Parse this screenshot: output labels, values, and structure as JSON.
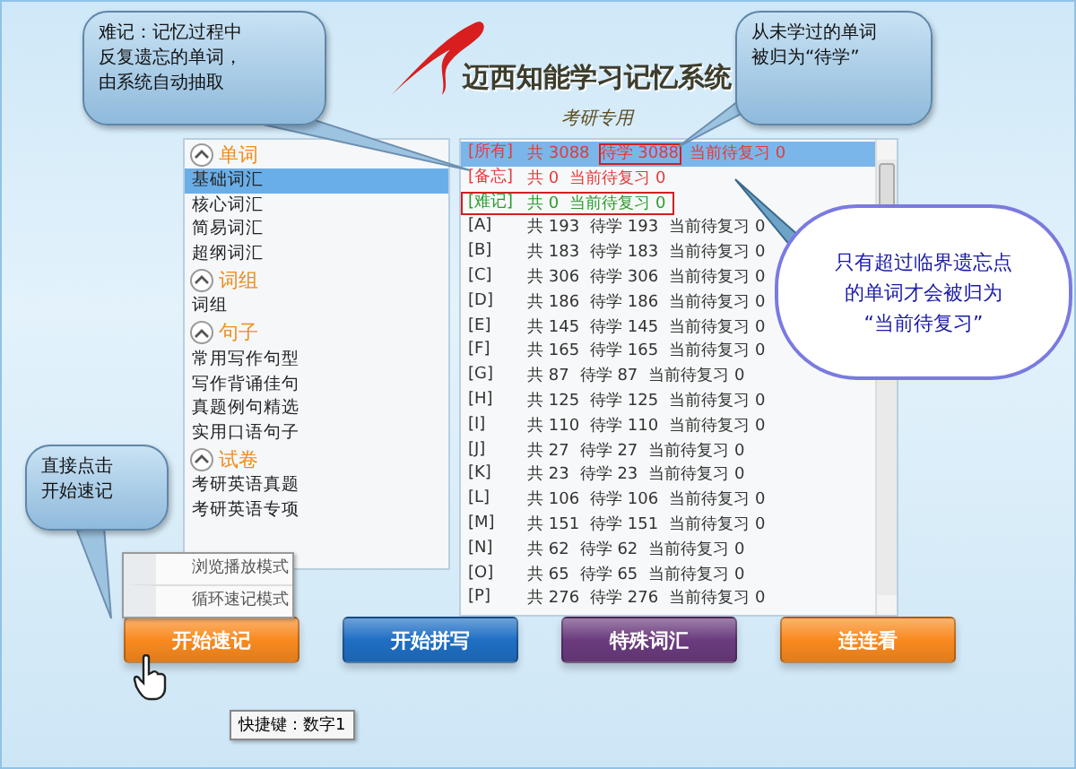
{
  "logo": {
    "title": "迈西知能学习记忆系统",
    "subtitle": "考研专用"
  },
  "sidebar": {
    "groups": [
      {
        "title": "单词",
        "expanded": true,
        "items": [
          {
            "label": "基础词汇",
            "selected": true
          },
          {
            "label": "核心词汇",
            "selected": false
          },
          {
            "label": "简易词汇",
            "selected": false
          },
          {
            "label": "超纲词汇",
            "selected": false
          }
        ]
      },
      {
        "title": "词组",
        "expanded": true,
        "items": [
          {
            "label": "词组",
            "selected": false
          }
        ]
      },
      {
        "title": "句子",
        "expanded": true,
        "items": [
          {
            "label": "常用写作句型",
            "selected": false
          },
          {
            "label": "写作背诵佳句",
            "selected": false
          },
          {
            "label": "真题例句精选",
            "selected": false
          },
          {
            "label": "实用口语句子",
            "selected": false
          }
        ]
      },
      {
        "title": "试卷",
        "expanded": true,
        "items": [
          {
            "label": "考研英语真题",
            "selected": false
          },
          {
            "label": "考研英语专项",
            "selected": false
          }
        ]
      }
    ]
  },
  "word_list": {
    "rows": [
      {
        "kind": "all",
        "tag": "[所有]",
        "selected": true,
        "boxed": false,
        "segments": [
          {
            "text": "共 3088",
            "boxed": false
          },
          {
            "text": "待学 3088",
            "boxed": true
          },
          {
            "text": "当前待复习 0",
            "boxed": false
          }
        ]
      },
      {
        "kind": "memo",
        "tag": "[备忘]",
        "selected": false,
        "boxed": false,
        "segments": [
          {
            "text": "共 0",
            "boxed": false
          },
          {
            "text": "当前待复习 0",
            "boxed": false
          }
        ]
      },
      {
        "kind": "hard",
        "tag": "[难记]",
        "selected": false,
        "boxed": true,
        "segments": [
          {
            "text": "共 0",
            "boxed": false
          },
          {
            "text": "当前待复习 0",
            "boxed": false
          }
        ]
      },
      {
        "kind": "letter",
        "tag": "[A]",
        "selected": false,
        "boxed": false,
        "segments": [
          {
            "text": "共 193",
            "boxed": false
          },
          {
            "text": "待学 193",
            "boxed": false
          },
          {
            "text": "当前待复习 0",
            "boxed": false
          }
        ]
      },
      {
        "kind": "letter",
        "tag": "[B]",
        "selected": false,
        "boxed": false,
        "segments": [
          {
            "text": "共 183",
            "boxed": false
          },
          {
            "text": "待学 183",
            "boxed": false
          },
          {
            "text": "当前待复习 0",
            "boxed": false
          }
        ]
      },
      {
        "kind": "letter",
        "tag": "[C]",
        "selected": false,
        "boxed": false,
        "segments": [
          {
            "text": "共 306",
            "boxed": false
          },
          {
            "text": "待学 306",
            "boxed": false
          },
          {
            "text": "当前待复习 0",
            "boxed": false
          }
        ]
      },
      {
        "kind": "letter",
        "tag": "[D]",
        "selected": false,
        "boxed": false,
        "segments": [
          {
            "text": "共 186",
            "boxed": false
          },
          {
            "text": "待学 186",
            "boxed": false
          },
          {
            "text": "当前待复习 0",
            "boxed": false
          }
        ]
      },
      {
        "kind": "letter",
        "tag": "[E]",
        "selected": false,
        "boxed": false,
        "segments": [
          {
            "text": "共 145",
            "boxed": false
          },
          {
            "text": "待学 145",
            "boxed": false
          },
          {
            "text": "当前待复习 0",
            "boxed": false
          }
        ]
      },
      {
        "kind": "letter",
        "tag": "[F]",
        "selected": false,
        "boxed": false,
        "segments": [
          {
            "text": "共 165",
            "boxed": false
          },
          {
            "text": "待学 165",
            "boxed": false
          },
          {
            "text": "当前待复习 0",
            "boxed": false
          }
        ]
      },
      {
        "kind": "letter",
        "tag": "[G]",
        "selected": false,
        "boxed": false,
        "segments": [
          {
            "text": "共 87",
            "boxed": false
          },
          {
            "text": "待学 87",
            "boxed": false
          },
          {
            "text": "当前待复习 0",
            "boxed": false
          }
        ]
      },
      {
        "kind": "letter",
        "tag": "[H]",
        "selected": false,
        "boxed": false,
        "segments": [
          {
            "text": "共 125",
            "boxed": false
          },
          {
            "text": "待学 125",
            "boxed": false
          },
          {
            "text": "当前待复习 0",
            "boxed": false
          }
        ]
      },
      {
        "kind": "letter",
        "tag": "[I]",
        "selected": false,
        "boxed": false,
        "segments": [
          {
            "text": "共 110",
            "boxed": false
          },
          {
            "text": "待学 110",
            "boxed": false
          },
          {
            "text": "当前待复习 0",
            "boxed": false
          }
        ]
      },
      {
        "kind": "letter",
        "tag": "[J]",
        "selected": false,
        "boxed": false,
        "segments": [
          {
            "text": "共 27",
            "boxed": false
          },
          {
            "text": "待学 27",
            "boxed": false
          },
          {
            "text": "当前待复习 0",
            "boxed": false
          }
        ]
      },
      {
        "kind": "letter",
        "tag": "[K]",
        "selected": false,
        "boxed": false,
        "segments": [
          {
            "text": "共 23",
            "boxed": false
          },
          {
            "text": "待学 23",
            "boxed": false
          },
          {
            "text": "当前待复习 0",
            "boxed": false
          }
        ]
      },
      {
        "kind": "letter",
        "tag": "[L]",
        "selected": false,
        "boxed": false,
        "segments": [
          {
            "text": "共 106",
            "boxed": false
          },
          {
            "text": "待学 106",
            "boxed": false
          },
          {
            "text": "当前待复习 0",
            "boxed": false
          }
        ]
      },
      {
        "kind": "letter",
        "tag": "[M]",
        "selected": false,
        "boxed": false,
        "segments": [
          {
            "text": "共 151",
            "boxed": false
          },
          {
            "text": "待学 151",
            "boxed": false
          },
          {
            "text": "当前待复习 0",
            "boxed": false
          }
        ]
      },
      {
        "kind": "letter",
        "tag": "[N]",
        "selected": false,
        "boxed": false,
        "segments": [
          {
            "text": "共 62",
            "boxed": false
          },
          {
            "text": "待学 62",
            "boxed": false
          },
          {
            "text": "当前待复习 0",
            "boxed": false
          }
        ]
      },
      {
        "kind": "letter",
        "tag": "[O]",
        "selected": false,
        "boxed": false,
        "segments": [
          {
            "text": "共 65",
            "boxed": false
          },
          {
            "text": "待学 65",
            "boxed": false
          },
          {
            "text": "当前待复习 0",
            "boxed": false
          }
        ]
      },
      {
        "kind": "letter",
        "tag": "[P]",
        "selected": false,
        "boxed": false,
        "segments": [
          {
            "text": "共 276",
            "boxed": false
          },
          {
            "text": "待学 276",
            "boxed": false
          },
          {
            "text": "当前待复习 0",
            "boxed": false
          }
        ]
      }
    ]
  },
  "mode_menu": {
    "items": [
      {
        "label": "浏览播放模式"
      },
      {
        "label": "循环速记模式"
      }
    ]
  },
  "buttons": [
    {
      "label": "开始速记",
      "color": "#f98a1f"
    },
    {
      "label": "开始拼写",
      "color": "#1f6fc4"
    },
    {
      "label": "特殊词汇",
      "color": "#6b3b7e"
    },
    {
      "label": "连连看",
      "color": "#f98a1f"
    }
  ],
  "tooltip": "快捷键：数字1",
  "callouts": [
    {
      "kind": "bubble",
      "lines": [
        "难记：记忆过程中",
        "反复遗忘的单词，",
        "由系统自动抽取"
      ]
    },
    {
      "kind": "bubble",
      "lines": [
        "从未学过的单词",
        "被归为“待学”"
      ]
    },
    {
      "kind": "cloud",
      "lines": [
        "只有超过临界遗忘点",
        "的单词才会被归为",
        "“当前待复习”"
      ]
    },
    {
      "kind": "bubble",
      "lines": [
        "直接点击",
        "开始速记"
      ]
    }
  ]
}
